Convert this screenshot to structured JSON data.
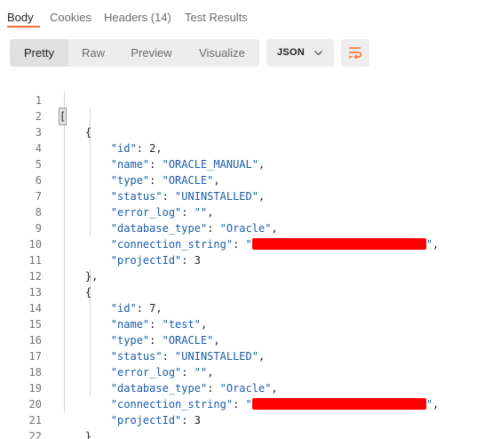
{
  "tabs": [
    {
      "label": "Body"
    },
    {
      "label": "Cookies"
    },
    {
      "label": "Headers (14)"
    },
    {
      "label": "Test Results"
    }
  ],
  "modes": [
    {
      "label": "Pretty"
    },
    {
      "label": "Raw"
    },
    {
      "label": "Preview"
    },
    {
      "label": "Visualize"
    }
  ],
  "format": {
    "label": "JSON",
    "icon": "chevron-down-icon"
  },
  "wrap": {
    "icon": "wrap-lines-icon",
    "color": "#ff6c37"
  },
  "line_numbers": [
    "1",
    "2",
    "3",
    "4",
    "5",
    "6",
    "7",
    "8",
    "9",
    "10",
    "11",
    "12",
    "13",
    "14",
    "15",
    "16",
    "17",
    "18",
    "19",
    "20",
    "21",
    "22"
  ],
  "json": {
    "open_array": "[",
    "close_array": "]",
    "objects": [
      {
        "id": "2",
        "name": "\"ORACLE_MANUAL\"",
        "type": "\"ORACLE\"",
        "status": "\"UNINSTALLED\"",
        "error_log": "\"\"",
        "database_type": "\"Oracle\"",
        "projectId": "3"
      },
      {
        "id": "7",
        "name": "\"test\"",
        "type": "\"ORACLE\"",
        "status": "\"UNINSTALLED\"",
        "error_log": "\"\"",
        "database_type": "\"Oracle\"",
        "projectId": "3"
      }
    ],
    "keys": {
      "id": "\"id\"",
      "name": "\"name\"",
      "type": "\"type\"",
      "status": "\"status\"",
      "error_log": "\"error_log\"",
      "database_type": "\"database_type\"",
      "connection_string": "\"connection_string\"",
      "projectId": "\"projectId\""
    }
  },
  "colors": {
    "accent": "#ff6c37",
    "redaction": "#ff0000",
    "json_string": "#1a5ca8"
  }
}
